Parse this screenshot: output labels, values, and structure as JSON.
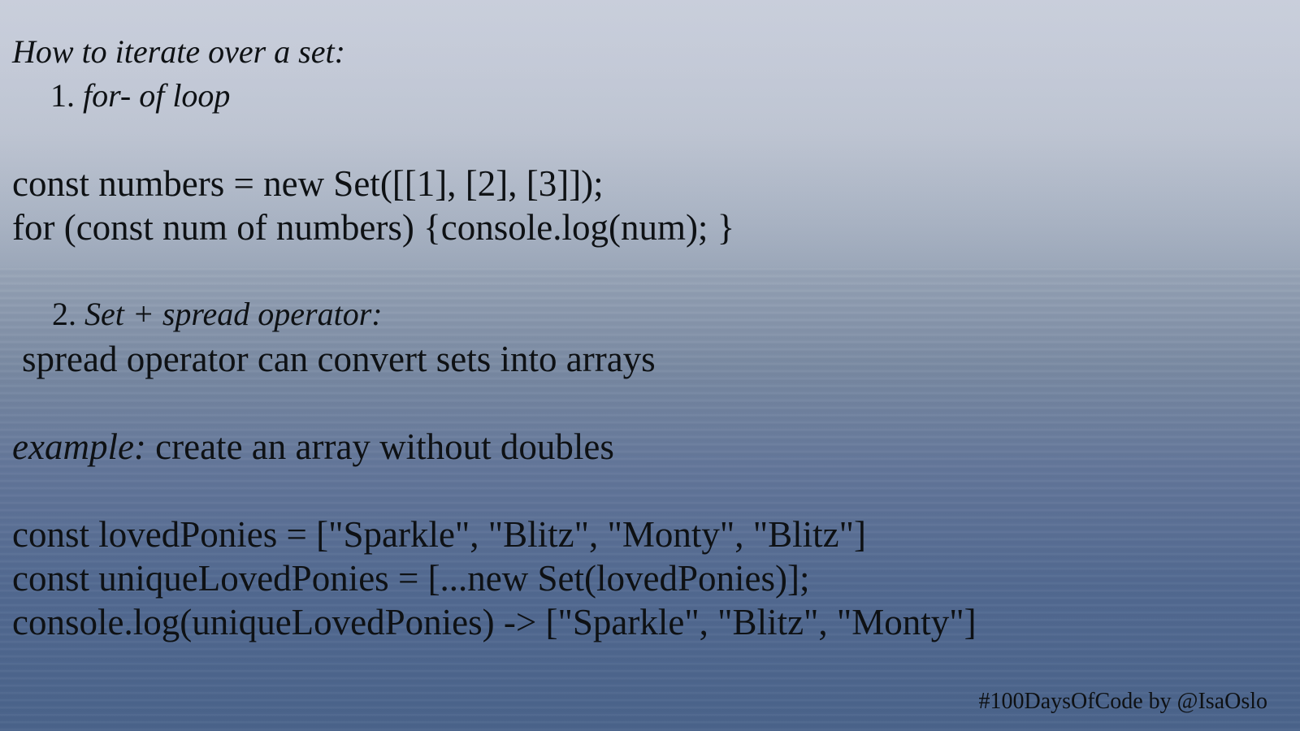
{
  "heading": "How to iterate over a set:",
  "item1": {
    "number": "1.",
    "label": "for- of loop"
  },
  "code1": [
    "const numbers = new Set([[1], [2], [3]]);",
    "for (const num of numbers) {console.log(num); }"
  ],
  "item2": {
    "number": "2.",
    "label": "Set + spread operator:"
  },
  "description": "spread operator can convert sets into arrays",
  "example": {
    "label": "example:",
    "text": " create an array without doubles"
  },
  "code2": [
    "const lovedPonies = [\"Sparkle\", \"Blitz\", \"Monty\", \"Blitz\"]",
    "const uniqueLovedPonies = [...new Set(lovedPonies)];",
    "console.log(uniqueLovedPonies) -> [\"Sparkle\", \"Blitz\", \"Monty\"]"
  ],
  "signature": "#100DaysOfCode by @IsaOslo"
}
